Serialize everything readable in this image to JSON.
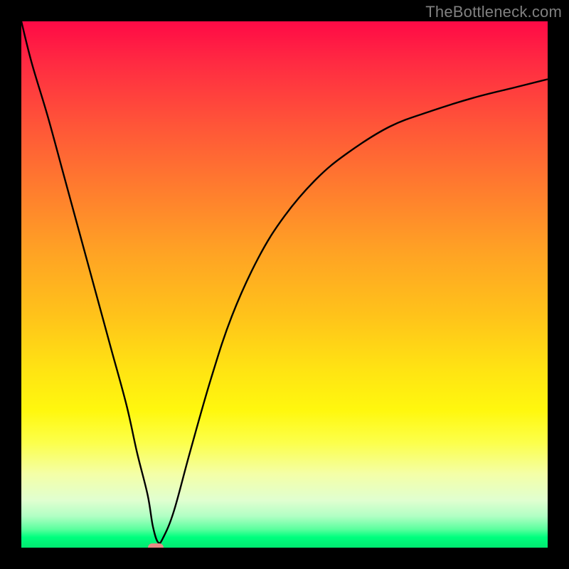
{
  "watermark": "TheBottleneck.com",
  "chart_data": {
    "type": "line",
    "title": "",
    "xlabel": "",
    "ylabel": "",
    "xlim": [
      0,
      100
    ],
    "ylim": [
      0,
      100
    ],
    "series": [
      {
        "name": "curve",
        "x": [
          0,
          2,
          5,
          8,
          11,
          14,
          17,
          20,
          22,
          24,
          25,
          26,
          27,
          29,
          32,
          36,
          40,
          45,
          50,
          56,
          62,
          70,
          78,
          86,
          94,
          100
        ],
        "values": [
          100,
          92,
          82,
          71,
          60,
          49,
          38,
          27,
          18,
          10,
          4,
          1,
          2,
          7,
          18,
          32,
          44,
          55,
          63,
          70,
          75,
          80,
          83,
          85.5,
          87.5,
          89
        ]
      }
    ],
    "marker": {
      "x": 25.5,
      "y": 0
    },
    "grid": false,
    "legend": false,
    "background_gradient": {
      "orientation": "vertical",
      "stops": [
        {
          "pos": 0.0,
          "color": "#ff0a46"
        },
        {
          "pos": 0.32,
          "color": "#ff7d2e"
        },
        {
          "pos": 0.66,
          "color": "#ffe313"
        },
        {
          "pos": 0.86,
          "color": "#f4ffa7"
        },
        {
          "pos": 0.98,
          "color": "#00ff7e"
        },
        {
          "pos": 1.0,
          "color": "#00e870"
        }
      ]
    }
  }
}
